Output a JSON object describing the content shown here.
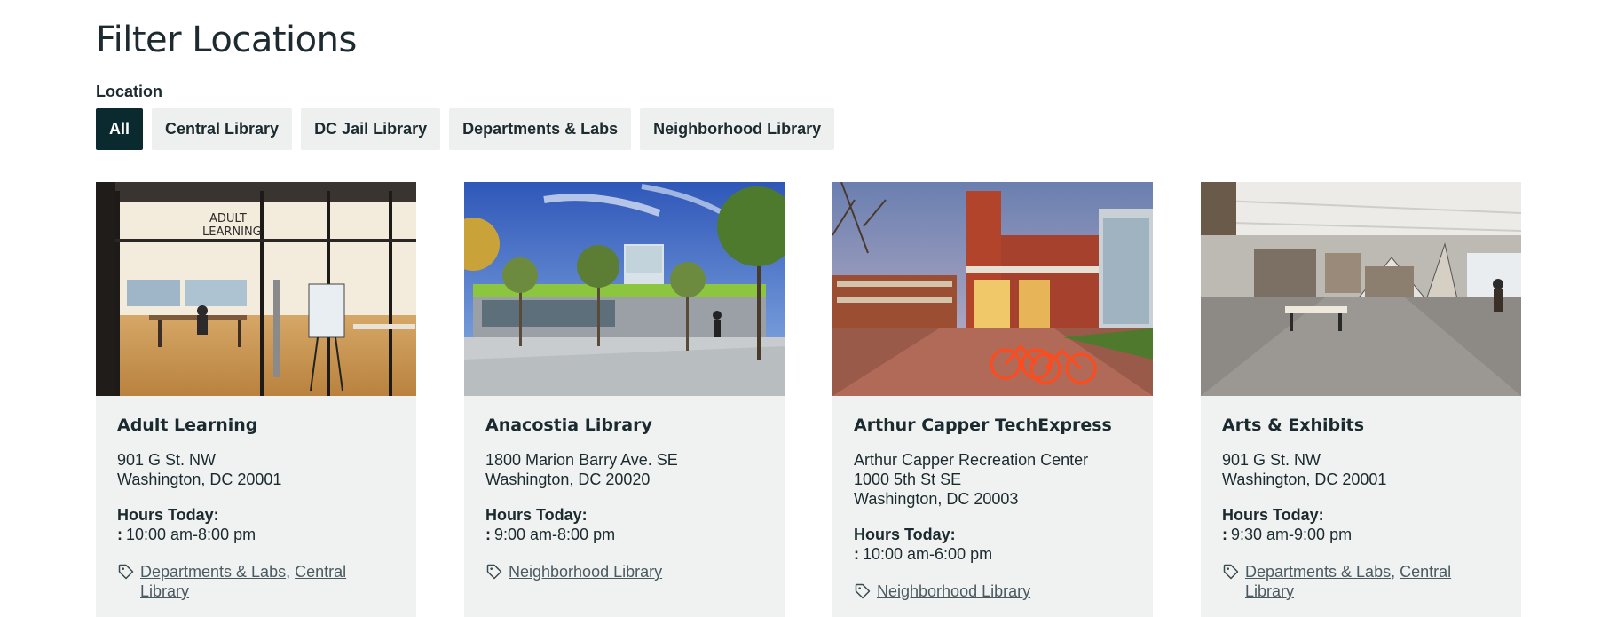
{
  "page": {
    "title": "Filter Locations"
  },
  "filters": {
    "label": "Location",
    "options": [
      {
        "label": "All",
        "active": true
      },
      {
        "label": "Central Library",
        "active": false
      },
      {
        "label": "DC Jail Library",
        "active": false
      },
      {
        "label": "Departments & Labs",
        "active": false
      },
      {
        "label": "Neighborhood Library",
        "active": false
      }
    ]
  },
  "cards": [
    {
      "title": "Adult Learning",
      "address": [
        "901 G St. NW",
        "Washington, DC 20001"
      ],
      "hours_label": "Hours Today:",
      "hours_colon": ":",
      "hours": "10:00 am-8:00 pm",
      "tags": [
        "Departments & Labs",
        "Central Library"
      ],
      "image_sign_lines": [
        "ADULT",
        "LEARNING"
      ]
    },
    {
      "title": "Anacostia Library",
      "address": [
        "1800 Marion Barry Ave. SE",
        "Washington, DC 20020"
      ],
      "hours_label": "Hours Today:",
      "hours_colon": ":",
      "hours": "9:00 am-8:00 pm",
      "tags": [
        "Neighborhood Library"
      ]
    },
    {
      "title": "Arthur Capper TechExpress",
      "address": [
        "Arthur Capper Recreation Center",
        "1000 5th St SE",
        "Washington, DC 20003"
      ],
      "hours_label": "Hours Today:",
      "hours_colon": ":",
      "hours": "10:00 am-6:00 pm",
      "tags": [
        "Neighborhood Library"
      ]
    },
    {
      "title": "Arts & Exhibits",
      "address": [
        "901 G St. NW",
        "Washington, DC 20001"
      ],
      "hours_label": "Hours Today:",
      "hours_colon": ":",
      "hours": "9:30 am-9:00 pm",
      "tags": [
        "Departments & Labs",
        "Central Library"
      ]
    }
  ],
  "icons": {
    "tag": "tag-icon"
  },
  "colors": {
    "active_filter": "#0b2a30",
    "filter_bg": "#eef0ef",
    "card_bg": "#f0f2f1"
  }
}
